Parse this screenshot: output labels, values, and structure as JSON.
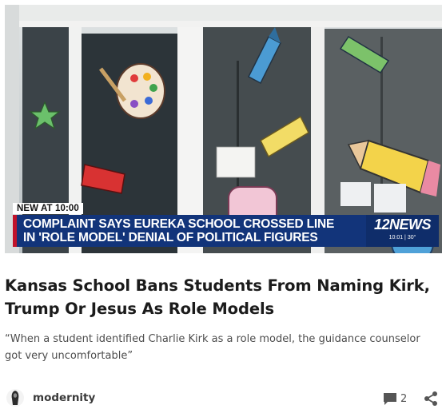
{
  "article": {
    "image": {
      "description_icon": "school-doors-photo",
      "overlay_tag": "NEW AT 10:00",
      "overlay_line1": "COMPLAINT SAYS EUREKA SCHOOL CROSSED LINE",
      "overlay_line2": "IN 'ROLE MODEL' DENIAL OF POLITICAL FIGURES",
      "station_logo": "12NEWS",
      "station_time": "10:01 | 30°",
      "colors": {
        "banner": "#12347a",
        "banner_accent": "#c0132b"
      }
    },
    "title": "Kansas School Bans Students From Naming Kirk, Trump Or Jesus As Role Models",
    "subtitle": "“When a student identified Charlie Kirk as a role model, the guidance counselor got very uncomfortable”",
    "author": {
      "name": "modernity",
      "avatar_icon": "hooded-figure-avatar"
    },
    "actions": {
      "comment_icon": "comment-bubble-icon",
      "comment_count": "2",
      "share_icon": "share-icon"
    }
  }
}
